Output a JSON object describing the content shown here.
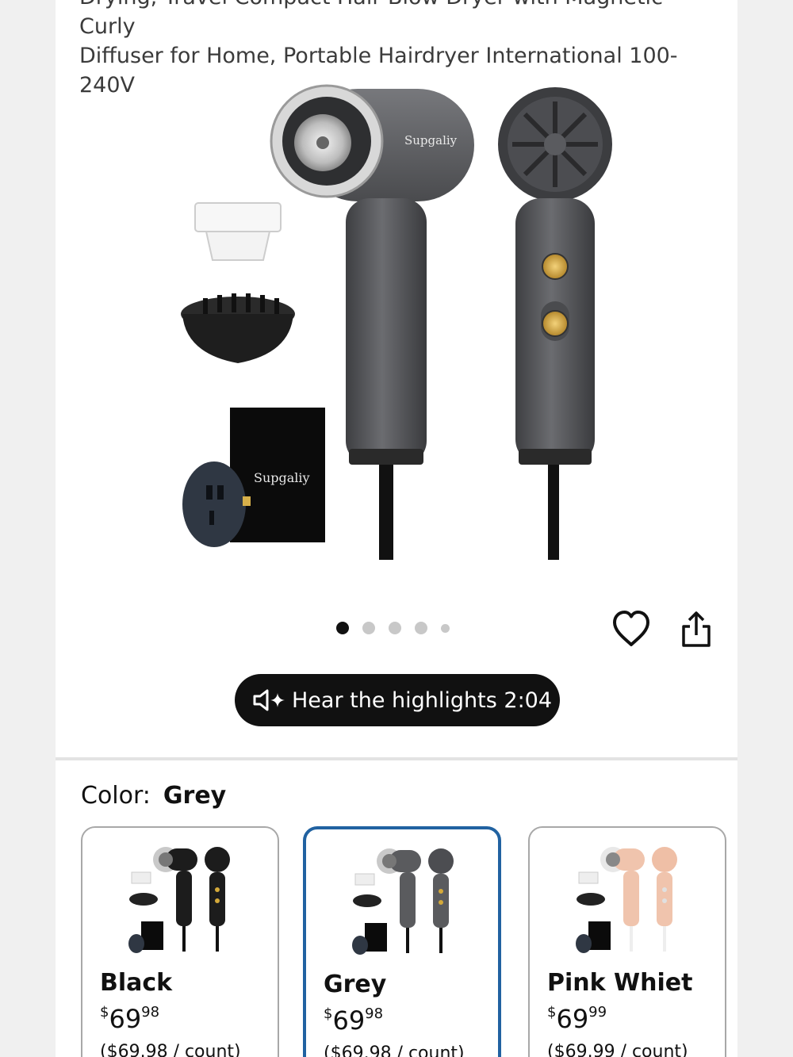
{
  "product": {
    "title_lines": [
      "Drying, Travel Compact Hair Blow Dryer with Magnetic Curly",
      "Diffuser for Home, Portable Hairdryer International 100-",
      "240V"
    ],
    "brand_on_image": "Supgaliy",
    "gallery": {
      "image_count": 5,
      "active_index": 0
    },
    "actions": {
      "favorite_icon": "heart-icon",
      "share_icon": "share-icon"
    }
  },
  "highlights_button": {
    "label": "Hear the highlights 2:04",
    "icon": "speaker-sparkle-icon"
  },
  "color": {
    "label": "Color:",
    "selected": "Grey",
    "options": [
      {
        "name": "Black",
        "price_symbol": "$",
        "price_whole": "69",
        "price_fraction": "98",
        "unit_price": "($69.98 / count)",
        "body_color": "#1c1c1c"
      },
      {
        "name": "Grey",
        "price_symbol": "$",
        "price_whole": "69",
        "price_fraction": "98",
        "unit_price": "($69.98 / count)",
        "body_color": "#5a5b5e"
      },
      {
        "name": "Pink Whiet",
        "price_symbol": "$",
        "price_whole": "69",
        "price_fraction": "99",
        "unit_price": "($69.99 / count)",
        "body_color": "#f0c4ad"
      }
    ]
  },
  "colors": {
    "selected_border": "#2162a1",
    "button_bg": "#111111",
    "accent_gold": "#d4a93a"
  }
}
